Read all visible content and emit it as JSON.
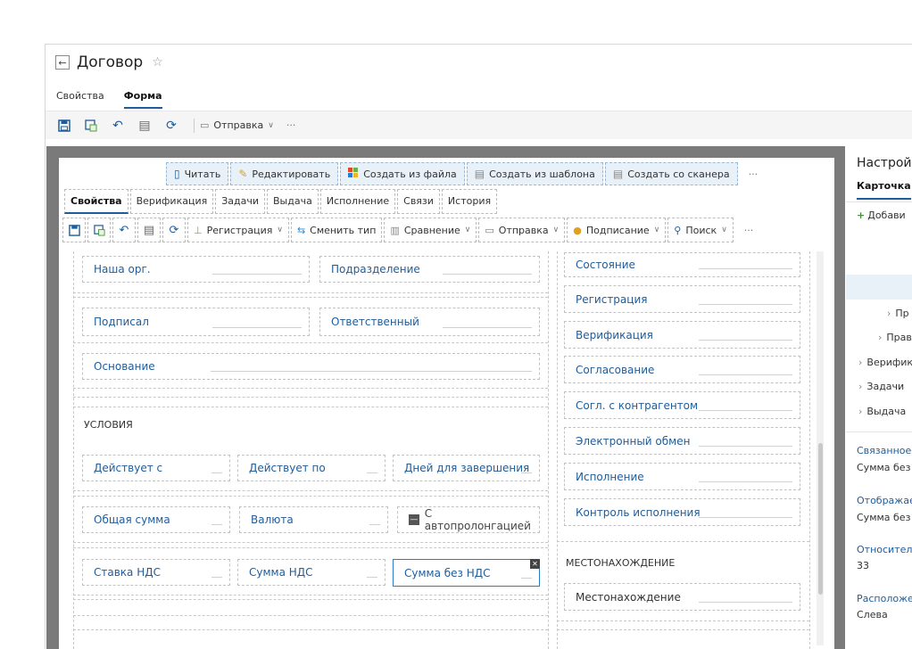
{
  "header": {
    "title": "Договор",
    "tabs": [
      "Свойства",
      "Форма"
    ],
    "active_tab": "Форма"
  },
  "page_toolbar": {
    "send_label": "Отправка",
    "more": "···"
  },
  "form": {
    "group_buttons": [
      "Читать",
      "Редактировать",
      "Создать из файла",
      "Создать из шаблона",
      "Создать со сканера"
    ],
    "group_more": "···",
    "tabs": [
      "Свойства",
      "Верификация",
      "Задачи",
      "Выдача",
      "Исполнение",
      "Связи",
      "История"
    ],
    "toolbar": {
      "registration": "Регистрация",
      "change_type": "Сменить тип",
      "compare": "Сравнение",
      "send": "Отправка",
      "sign": "Подписание",
      "search": "Поиск",
      "more": "···"
    },
    "left": {
      "our_org": "Наша орг.",
      "department": "Подразделение",
      "signed": "Подписал",
      "responsible": "Ответственный",
      "basis": "Основание",
      "conditions_header": "УСЛОВИЯ",
      "valid_from": "Действует с",
      "valid_to": "Действует по",
      "days_to_complete": "Дней для завершения",
      "total_sum": "Общая сумма",
      "currency": "Валюта",
      "auto_prolong": "С автопролонгацией",
      "vat_rate": "Ставка НДС",
      "vat_sum": "Сумма НДС",
      "sum_wo_vat": "Сумма без НДС"
    },
    "right": {
      "items": [
        "Состояние",
        "Регистрация",
        "Верификация",
        "Согласование",
        "Согл. с контрагентом",
        "Электронный обмен",
        "Исполнение",
        "Контроль исполнения"
      ],
      "location_header": "МЕСТОНАХОЖДЕНИЕ",
      "location": "Местонахождение"
    }
  },
  "settings": {
    "title": "Настройк",
    "tab": "Карточка",
    "add": "Добави",
    "tree": [
      "Пр",
      "Прав",
      "Верифик",
      "Задачи",
      "Выдача"
    ],
    "related_label": "Связанное",
    "related_value": "Сумма без",
    "display_label": "Отображае",
    "display_value": "Сумма без",
    "relative_label": "Относител",
    "relative_value": "33",
    "position_label": "Расположе",
    "position_value": "Слева"
  }
}
